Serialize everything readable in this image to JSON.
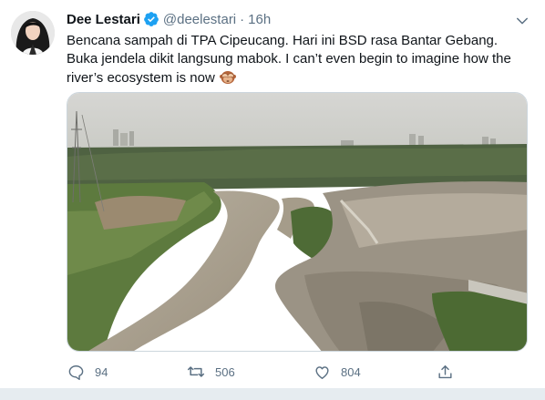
{
  "tweet": {
    "author": {
      "display_name": "Dee Lestari",
      "handle": "@deelestari",
      "verified": true
    },
    "separator": "·",
    "timestamp": "16h",
    "text_lines": [
      "Bencana sampah di TPA Cipeucang. Hari ini BSD rasa Bantar Gebang.",
      "Buka jendela dikit langsung mabok. I can’t even begin to imagine how the",
      "river’s  ecosystem is now"
    ],
    "emoji": "see-no-evil-monkey",
    "media": {
      "type": "photo"
    },
    "actions": {
      "reply_count": "94",
      "retweet_count": "506",
      "like_count": "804"
    }
  },
  "colors": {
    "text_primary": "#0f1419",
    "text_secondary": "#5b7083",
    "verified_blue": "#1da1f2",
    "border": "#ccd6dd",
    "background_strip": "#e6ecf0"
  },
  "icons": {
    "verified": "verified-badge-icon",
    "caret": "chevron-down-icon",
    "reply": "reply-icon",
    "retweet": "retweet-icon",
    "like": "heart-icon",
    "share": "share-icon"
  }
}
